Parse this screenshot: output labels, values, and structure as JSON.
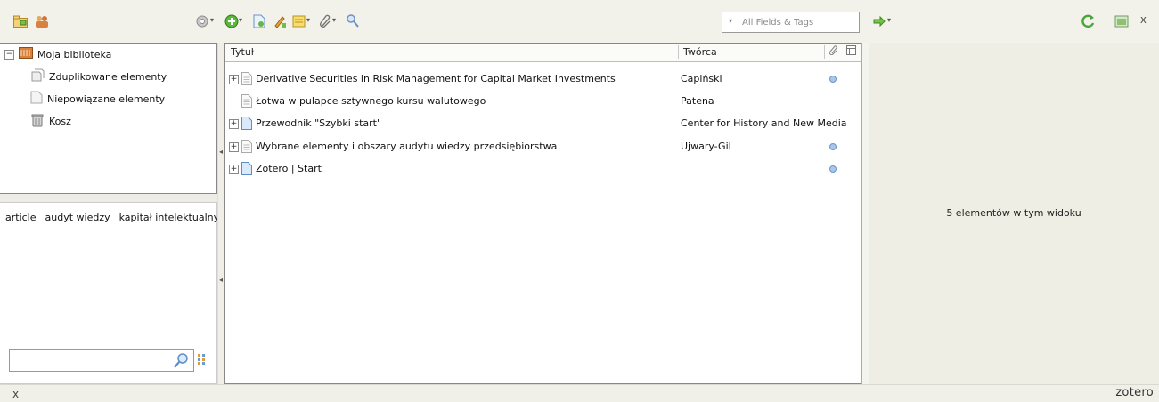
{
  "toolbar": {
    "search_placeholder": "All Fields & Tags",
    "close_label": "x"
  },
  "collections": [
    {
      "label": "Moja biblioteka",
      "icon": "library-icon"
    },
    {
      "label": "Zduplikowane elementy",
      "icon": "duplicates-icon"
    },
    {
      "label": "Niepowiązane elementy",
      "icon": "unfiled-icon"
    },
    {
      "label": "Kosz",
      "icon": "trash-icon"
    }
  ],
  "tags": [
    "article",
    "audyt wiedzy",
    "kapitał intelektualny"
  ],
  "items_header": {
    "title": "Tytuł",
    "creator": "Twórca"
  },
  "items": [
    {
      "title": "Derivative Securities in Risk Management for Capital Market Investments",
      "creator": "Capiński",
      "expandable": true,
      "attachment": true,
      "icon": "document-icon"
    },
    {
      "title": "Łotwa w pułapce sztywnego kursu walutowego",
      "creator": "Patena",
      "expandable": false,
      "attachment": false,
      "icon": "document-icon"
    },
    {
      "title": "Przewodnik \"Szybki start\"",
      "creator": "Center for History and New Media",
      "expandable": true,
      "attachment": false,
      "icon": "webpage-icon"
    },
    {
      "title": "Wybrane elementy i obszary audytu wiedzy przedsiębiorstwa",
      "creator": "Ujwary-Gil",
      "expandable": true,
      "attachment": true,
      "icon": "document-icon"
    },
    {
      "title": "Zotero | Start",
      "creator": "",
      "expandable": true,
      "attachment": true,
      "icon": "webpage-icon"
    }
  ],
  "item_pane": {
    "message": "5 elementów w tym widoku"
  },
  "statusbar": {
    "close_label": "x",
    "logo": "zotero"
  }
}
